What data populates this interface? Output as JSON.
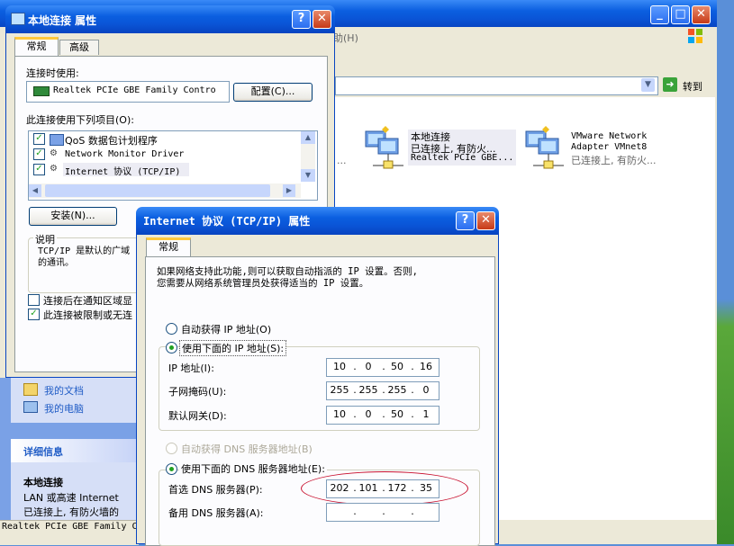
{
  "explorer": {
    "menu_help": "助(H)",
    "go_label": "转到",
    "connections": [
      {
        "name": "本地连接",
        "status": "已连接上, 有防火...",
        "device": "Realtek PCIe GBE..."
      },
      {
        "name": "VMware Network",
        "status": "Adapter VMnet8",
        "device": "已连接上, 有防火..."
      }
    ],
    "sidebar": {
      "links": [
        "我的文档",
        "我的电脑"
      ],
      "details_header": "详细信息",
      "details_title": "本地连接",
      "details_line1": "LAN 或高速 Internet",
      "details_line2": "已连接上, 有防火墙的"
    },
    "status_bar": "Realtek PCIe GBE Family C"
  },
  "props_dialog": {
    "title": "本地连接 属性",
    "tabs": [
      "常规",
      "高级"
    ],
    "connect_using_label": "连接时使用:",
    "adapter_name": "Realtek PCIe GBE Family Contro",
    "configure_button": "配置(C)...",
    "items_label": "此连接使用下列项目(O):",
    "items": [
      {
        "label": "QoS 数据包计划程序",
        "checked": true,
        "icon": "qos-icon"
      },
      {
        "label": "Network Monitor Driver",
        "checked": true,
        "icon": "network-icon"
      },
      {
        "label": "Internet 协议 (TCP/IP)",
        "checked": true,
        "icon": "network-icon"
      }
    ],
    "install_button": "安装(N)...",
    "description_label": "说明",
    "description_text_1": "TCP/IP 是默认的广域",
    "description_text_2": "的通讯。",
    "notify_checkbox": "连接后在通知区域显",
    "notify_checked": false,
    "limited_checkbox": "此连接被限制或无连",
    "limited_checked": true
  },
  "tcpip_dialog": {
    "title": "Internet 协议 (TCP/IP) 属性",
    "tab": "常规",
    "intro_1": "如果网络支持此功能,则可以获取自动指派的 IP 设置。否则,",
    "intro_2": "您需要从网络系统管理员处获得适当的 IP 设置。",
    "auto_ip": "自动获得 IP 地址(O)",
    "manual_ip": "使用下面的 IP 地址(S):",
    "ip_label": "IP 地址(I):",
    "ip": [
      "10",
      "0",
      "50",
      "16"
    ],
    "mask_label": "子网掩码(U):",
    "mask": [
      "255",
      "255",
      "255",
      "0"
    ],
    "gateway_label": "默认网关(D):",
    "gateway": [
      "10",
      "0",
      "50",
      "1"
    ],
    "auto_dns": "自动获得 DNS 服务器地址(B)",
    "manual_dns": "使用下面的 DNS 服务器地址(E):",
    "pref_dns_label": "首选 DNS 服务器(P):",
    "pref_dns": [
      "202",
      "101",
      "172",
      "35"
    ],
    "alt_dns_label": "备用 DNS 服务器(A):",
    "alt_dns": [
      "",
      "",
      "",
      ""
    ]
  },
  "colors": {
    "annotation": "#c8102e",
    "xp_blue": "#0a54d6"
  }
}
